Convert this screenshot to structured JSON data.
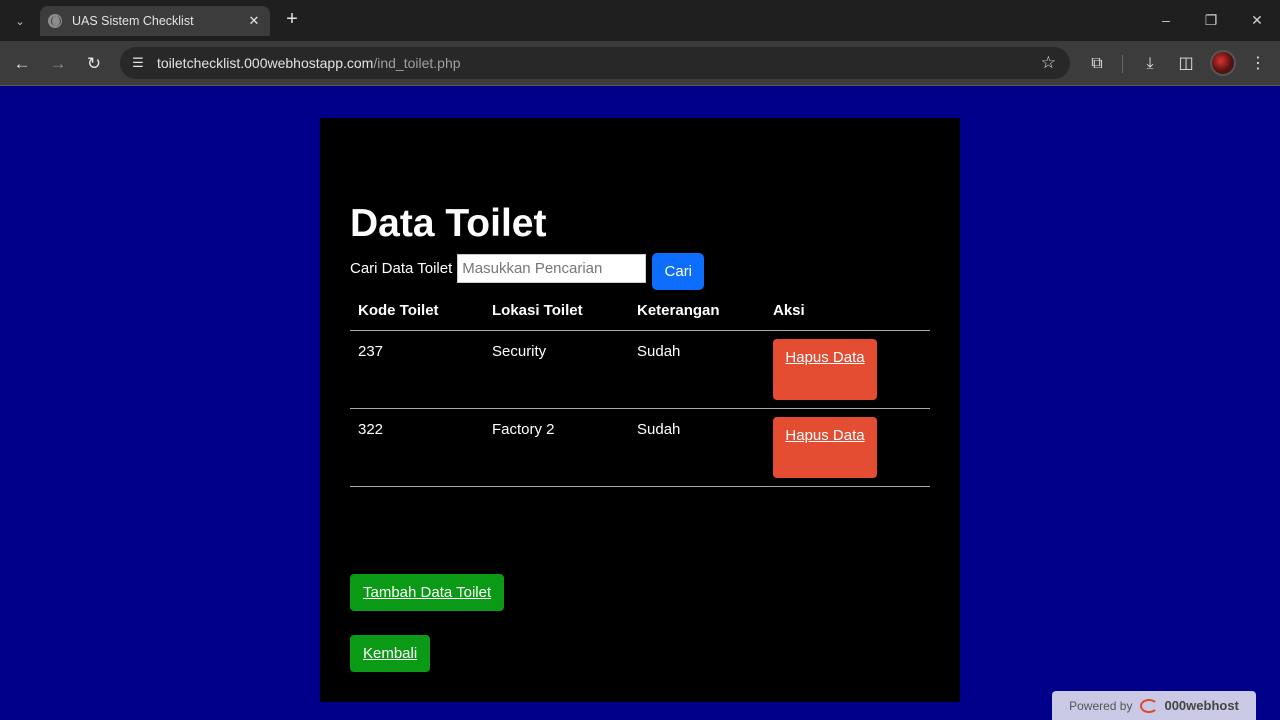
{
  "browser": {
    "tab_title": "UAS Sistem Checklist",
    "url_host": "toiletchecklist.000webhostapp.com",
    "url_path": "/ind_toilet.php"
  },
  "page": {
    "title": "Data Toilet",
    "search": {
      "label": "Cari Data Toilet",
      "placeholder": "Masukkan Pencarian",
      "value": "",
      "button": "Cari"
    },
    "table": {
      "headers": [
        "Kode Toilet",
        "Lokasi Toilet",
        "Keterangan",
        "Aksi"
      ],
      "rows": [
        {
          "kode": "237",
          "lokasi": "Security",
          "keterangan": "Sudah",
          "aksi": "Hapus Data"
        },
        {
          "kode": "322",
          "lokasi": "Factory 2",
          "keterangan": "Sudah",
          "aksi": "Hapus Data"
        }
      ]
    },
    "add_button": "Tambah Data Toilet",
    "back_button": "Kembali"
  },
  "footer": {
    "powered_by": "Powered by",
    "brand": "000webhost"
  },
  "colors": {
    "background": "#00008b",
    "card": "#000000",
    "primary": "#0d6efd",
    "danger": "#e44d32",
    "success": "#0b9a16"
  }
}
